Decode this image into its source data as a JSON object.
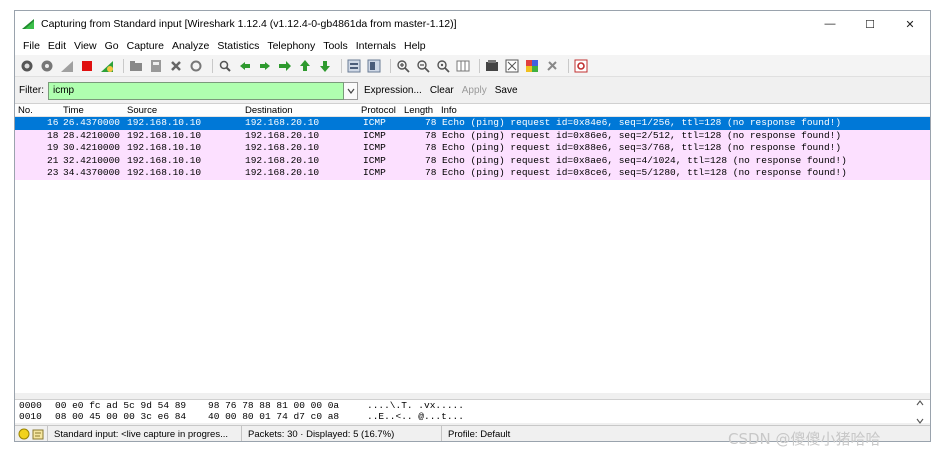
{
  "window": {
    "title": "Capturing from Standard input   [Wireshark 1.12.4  (v1.12.4-0-gb4861da from master-1.12)]",
    "controls": {
      "minimize": "—",
      "maximize": "☐",
      "close": "✕"
    }
  },
  "menu": [
    "File",
    "Edit",
    "View",
    "Go",
    "Capture",
    "Analyze",
    "Statistics",
    "Telephony",
    "Tools",
    "Internals",
    "Help"
  ],
  "filter": {
    "label": "Filter:",
    "value": "icmp",
    "expression_label": "Expression...",
    "clear_label": "Clear",
    "apply_label": "Apply",
    "save_label": "Save"
  },
  "packet_list": {
    "columns": {
      "no": "No.",
      "time": "Time",
      "source": "Source",
      "destination": "Destination",
      "protocol": "Protocol",
      "length": "Length",
      "info": "Info"
    },
    "rows": [
      {
        "no": "16",
        "time": "26.4370000",
        "source": "192.168.10.10",
        "destination": "192.168.20.10",
        "protocol": "ICMP",
        "length": "78",
        "info": "Echo (ping) request  id=0x84e6, seq=1/256, ttl=128 (no response found!)"
      },
      {
        "no": "18",
        "time": "28.4210000",
        "source": "192.168.10.10",
        "destination": "192.168.20.10",
        "protocol": "ICMP",
        "length": "78",
        "info": "Echo (ping) request  id=0x86e6, seq=2/512, ttl=128 (no response found!)"
      },
      {
        "no": "19",
        "time": "30.4210000",
        "source": "192.168.10.10",
        "destination": "192.168.20.10",
        "protocol": "ICMP",
        "length": "78",
        "info": "Echo (ping) request  id=0x88e6, seq=3/768, ttl=128 (no response found!)"
      },
      {
        "no": "21",
        "time": "32.4210000",
        "source": "192.168.10.10",
        "destination": "192.168.20.10",
        "protocol": "ICMP",
        "length": "78",
        "info": "Echo (ping) request  id=0x8ae6, seq=4/1024, ttl=128 (no response found!)"
      },
      {
        "no": "23",
        "time": "34.4370000",
        "source": "192.168.10.10",
        "destination": "192.168.20.10",
        "protocol": "ICMP",
        "length": "78",
        "info": "Echo (ping) request  id=0x8ce6, seq=5/1280, ttl=128 (no response found!)"
      }
    ]
  },
  "bytes": [
    {
      "offset": "0000",
      "hex1": "00 e0 fc ad 5c 9d 54 89",
      "hex2": "98 76 78 88 81 00 00 0a",
      "ascii": "....\\.T. .vx....."
    },
    {
      "offset": "0010",
      "hex1": "08 00 45 00 00 3c e6 84",
      "hex2": "40 00 80 01 74 d7 c0 a8",
      "ascii": "..E..<.. @...t..."
    }
  ],
  "status": {
    "capture": "Standard input: <live capture in progres...",
    "packets": "Packets: 30 · Displayed: 5 (16.7%)",
    "profile": "Profile: Default"
  },
  "watermark": "CSDN @傻傻小猪哈哈",
  "colors": {
    "selected_row": "#0078d7",
    "icmp_row": "#fce0ff",
    "filter_valid": "#afffaf"
  }
}
